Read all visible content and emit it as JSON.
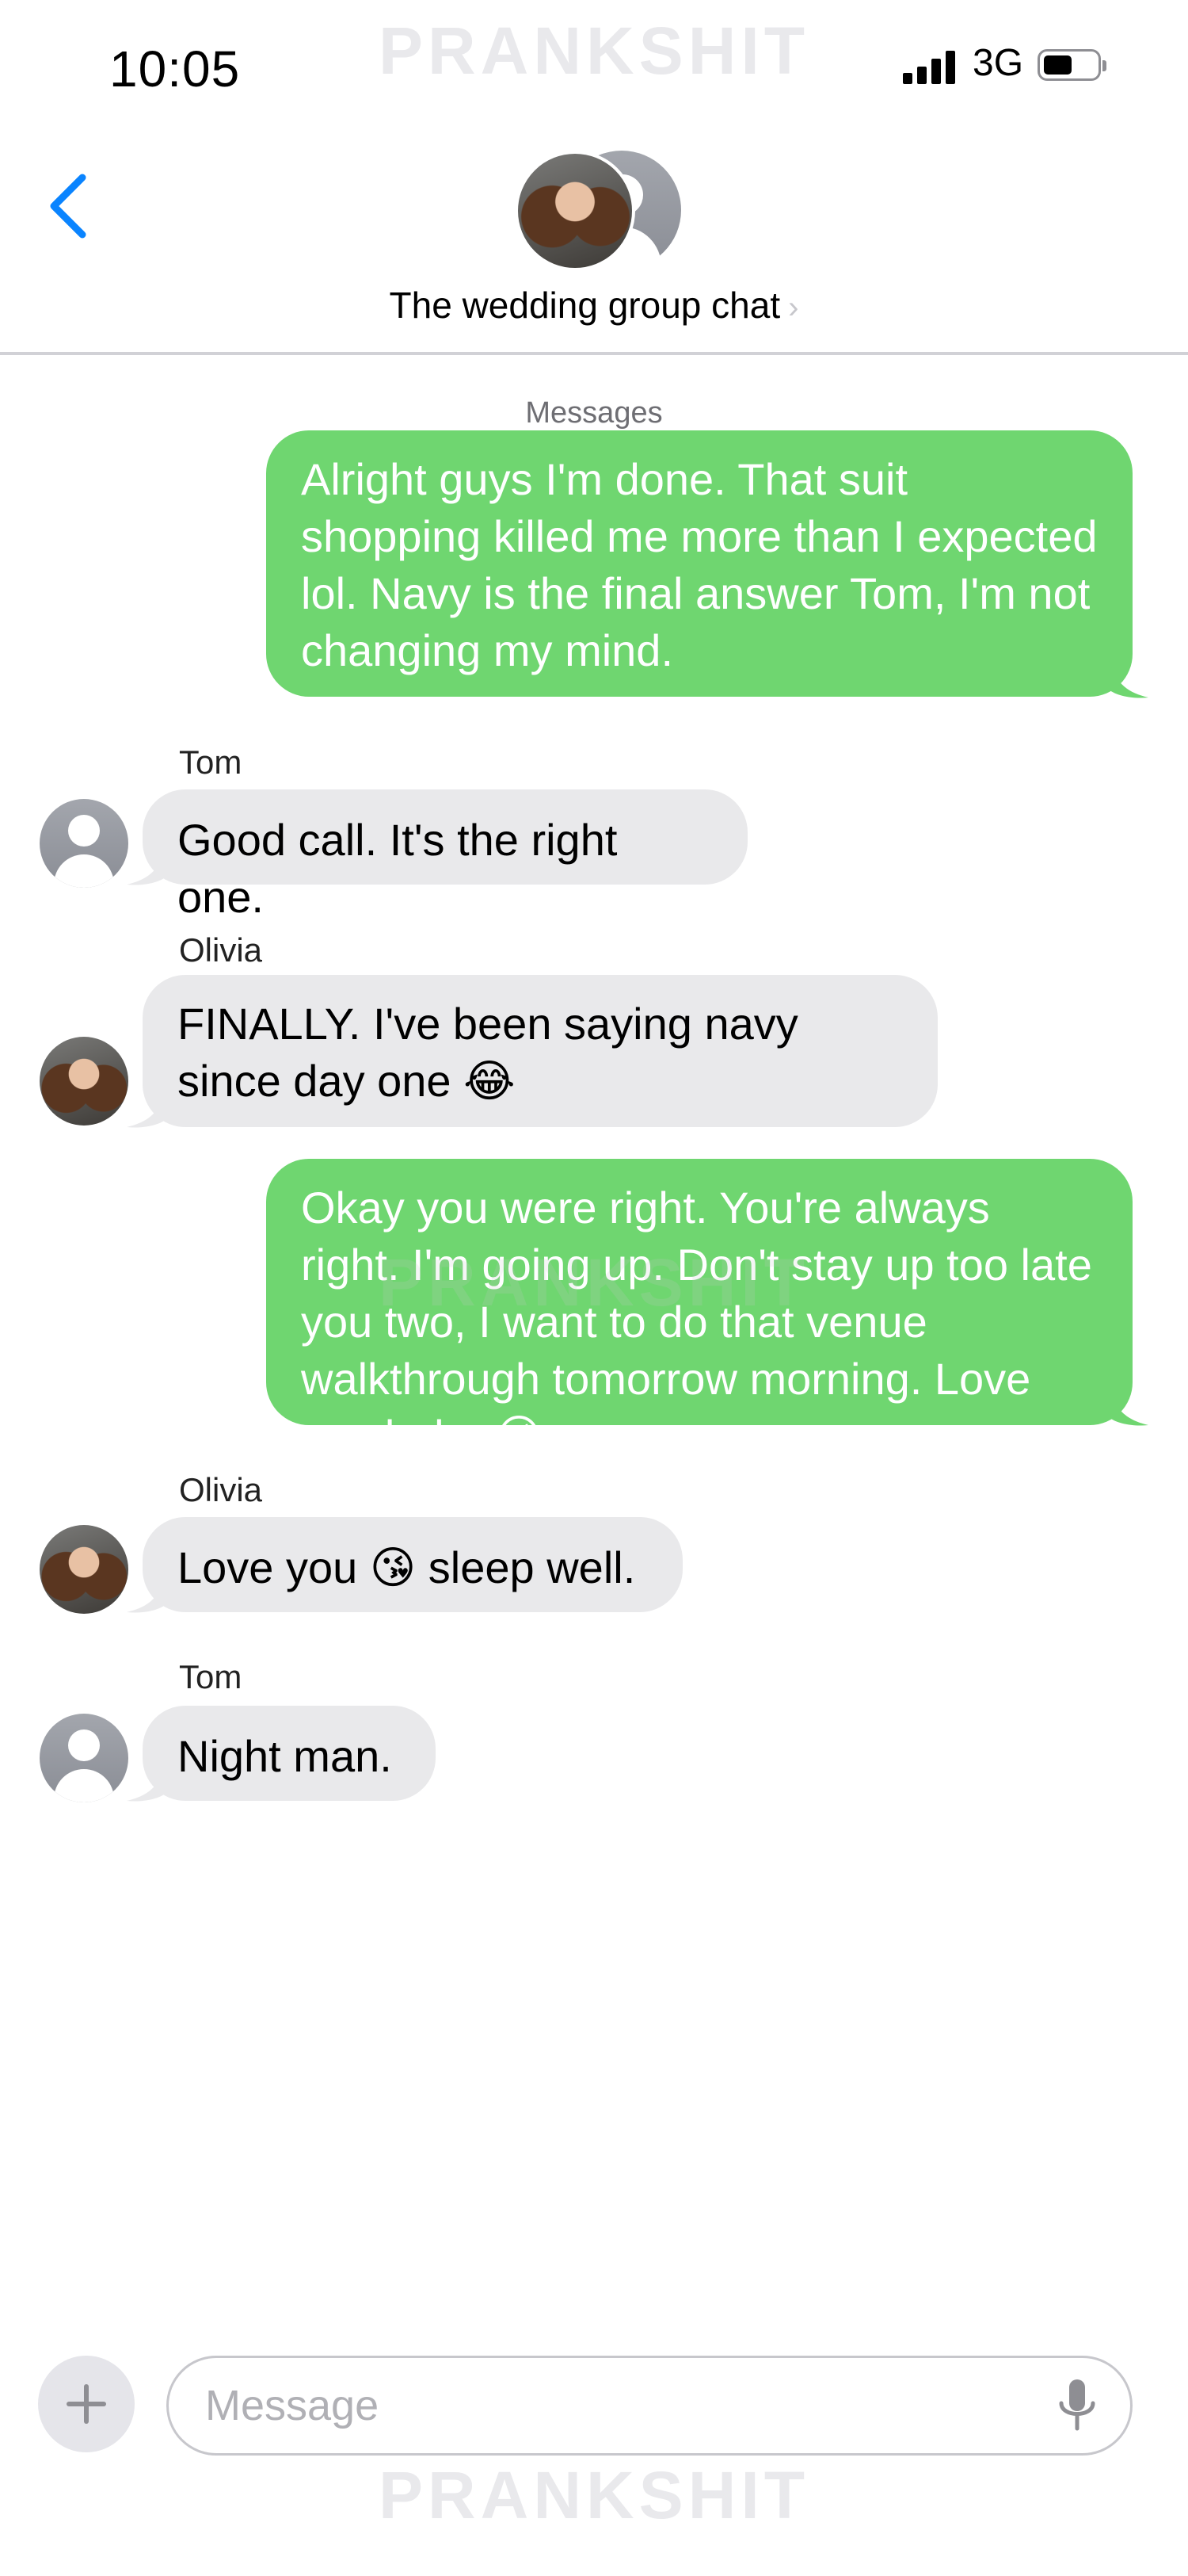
{
  "status_bar": {
    "time": "10:05",
    "network": "3G",
    "battery_level": 0.55
  },
  "watermark": "PRANKSHIT",
  "header": {
    "chat_title": "The wedding group chat",
    "back_icon": "chevron-left-icon",
    "accent_color": "#0a84ff"
  },
  "service_label": "Messages",
  "messages": [
    {
      "direction": "out",
      "text": "Alright guys I'm done. That suit shopping killed me more than I expected lol. Navy is the final answer Tom, I'm not changing my mind."
    },
    {
      "direction": "in",
      "sender": "Tom",
      "text": "Good call. It's the right one."
    },
    {
      "direction": "in",
      "sender": "Olivia",
      "text": "FINALLY. I've been saying navy since day one",
      "emoji": "😂"
    },
    {
      "direction": "out",
      "text": "Okay you were right. You're always right. I'm going up. Don't stay up too late you two, I want to do that venue walkthrough tomorrow morning. Love you babe",
      "emoji": "😘"
    },
    {
      "direction": "in",
      "sender": "Olivia",
      "text_before": "Love you",
      "emoji": "😘",
      "text_after": "sleep well."
    },
    {
      "direction": "in",
      "sender": "Tom",
      "text": "Night man."
    }
  ],
  "composer": {
    "placeholder": "Message"
  },
  "colors": {
    "outgoing_bubble": "#6fd670",
    "incoming_bubble": "#e9e9eb"
  }
}
